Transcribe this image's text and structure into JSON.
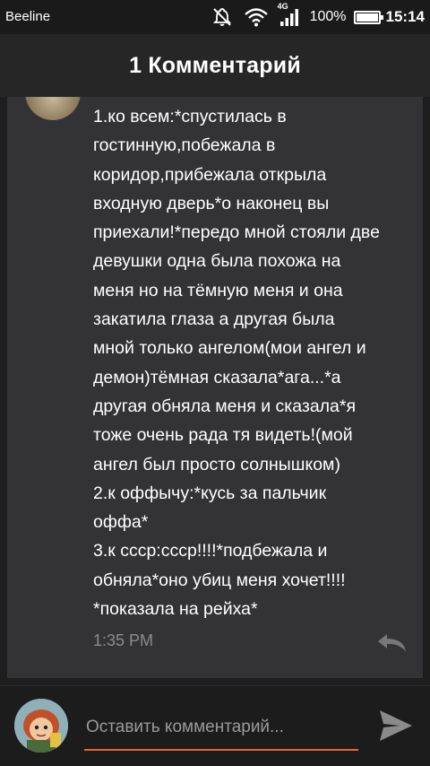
{
  "status_bar": {
    "carrier": "Beeline",
    "network": "4G",
    "battery": "100%",
    "battery_level": 1.0,
    "time": "15:14",
    "icons": [
      "mute-icon",
      "wifi-icon",
      "signal-icon",
      "battery-icon"
    ]
  },
  "header": {
    "title": "1 Комментарий"
  },
  "comment": {
    "text": "1.ко всем:*спустилась в\nгостинную,побежала в\nкоридор,прибежала открыла\nвходную дверь*о наконец вы\nприехали!*передо мной стояли две\nдевушки одна была похожа на\nменя но на тёмную меня и она\nзакатила глаза а другая была\nмной только ангелом(мои ангел и\nдемон)тёмная сказала*ага...*а\nдругая обняла меня и сказала*я\nтоже очень рада тя видеть!(мой\nангел был просто солнышком)\n2.к оффычу:*кусь за пальчик\nоффа*\n3.к ссср:ссср!!!!*подбежала и\nобняла*оно убиц меня хочет!!!!\n*показала на рейха*",
    "time": "1:35 PM",
    "icons": [
      "reply-icon"
    ]
  },
  "composer": {
    "placeholder": "Оставить комментарий...",
    "value": "",
    "icons": [
      "send-icon"
    ]
  },
  "colors": {
    "accent": "#f0612e",
    "card_bg": "#333336",
    "header_bg": "#262626",
    "background": "#1e1e1e",
    "muted_text": "#8c8c8c"
  }
}
